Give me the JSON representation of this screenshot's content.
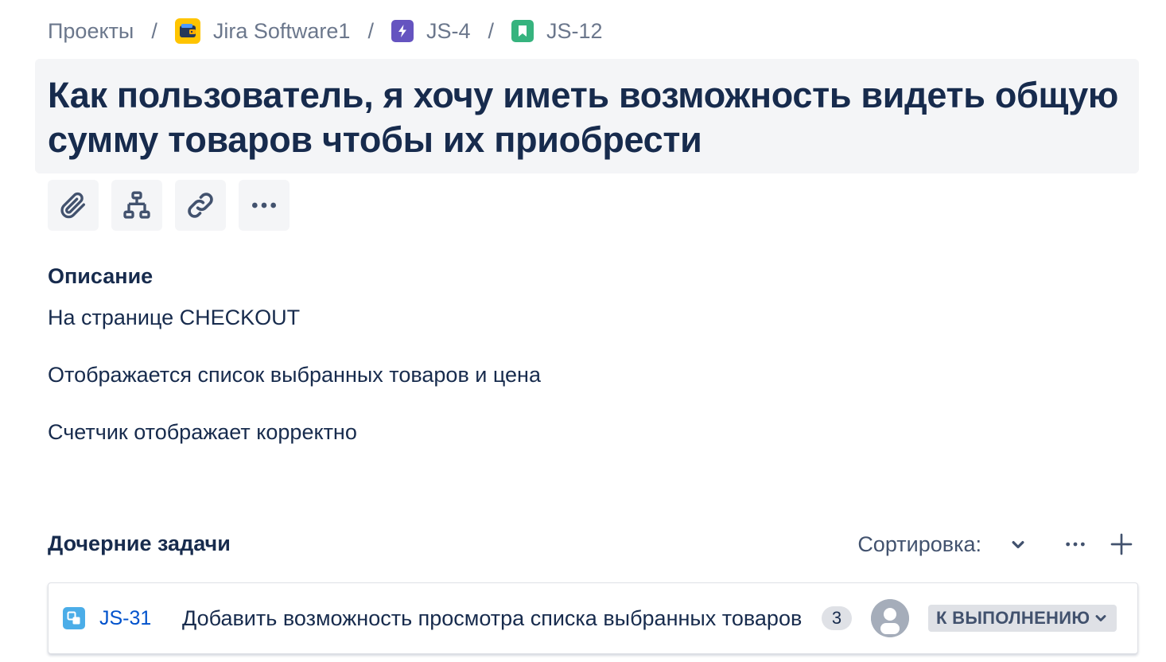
{
  "breadcrumbs": {
    "projects": "Проекты",
    "project": "Jira Software1",
    "epic": "JS-4",
    "issue": "JS-12",
    "separator": "/"
  },
  "issue": {
    "title": "Как пользователь, я хочу иметь возможность видеть общую сумму товаров чтобы их приобрести"
  },
  "toolbar": {
    "icons": [
      "paperclip-icon",
      "child-issues-icon",
      "link-icon",
      "more-icon"
    ]
  },
  "description": {
    "heading": "Описание",
    "lines": [
      "На странице CHECKOUT",
      "Отображается список выбранных товаров и цена",
      "Счетчик отображает корректно"
    ]
  },
  "child_issues": {
    "heading": "Дочерние задачи",
    "sort_label": "Сортировка:",
    "items": [
      {
        "key": "JS-31",
        "summary": "Добавить возможность просмотра списка выбранных товаров",
        "count": "3",
        "status": "К ВЫПОЛНЕНИЮ"
      }
    ]
  },
  "colors": {
    "project_icon": "#ffc400",
    "epic_icon": "#6554c0",
    "story_icon": "#36b37e",
    "subtask_icon": "#4bade8",
    "link": "#0052cc",
    "text": "#172b4d"
  }
}
